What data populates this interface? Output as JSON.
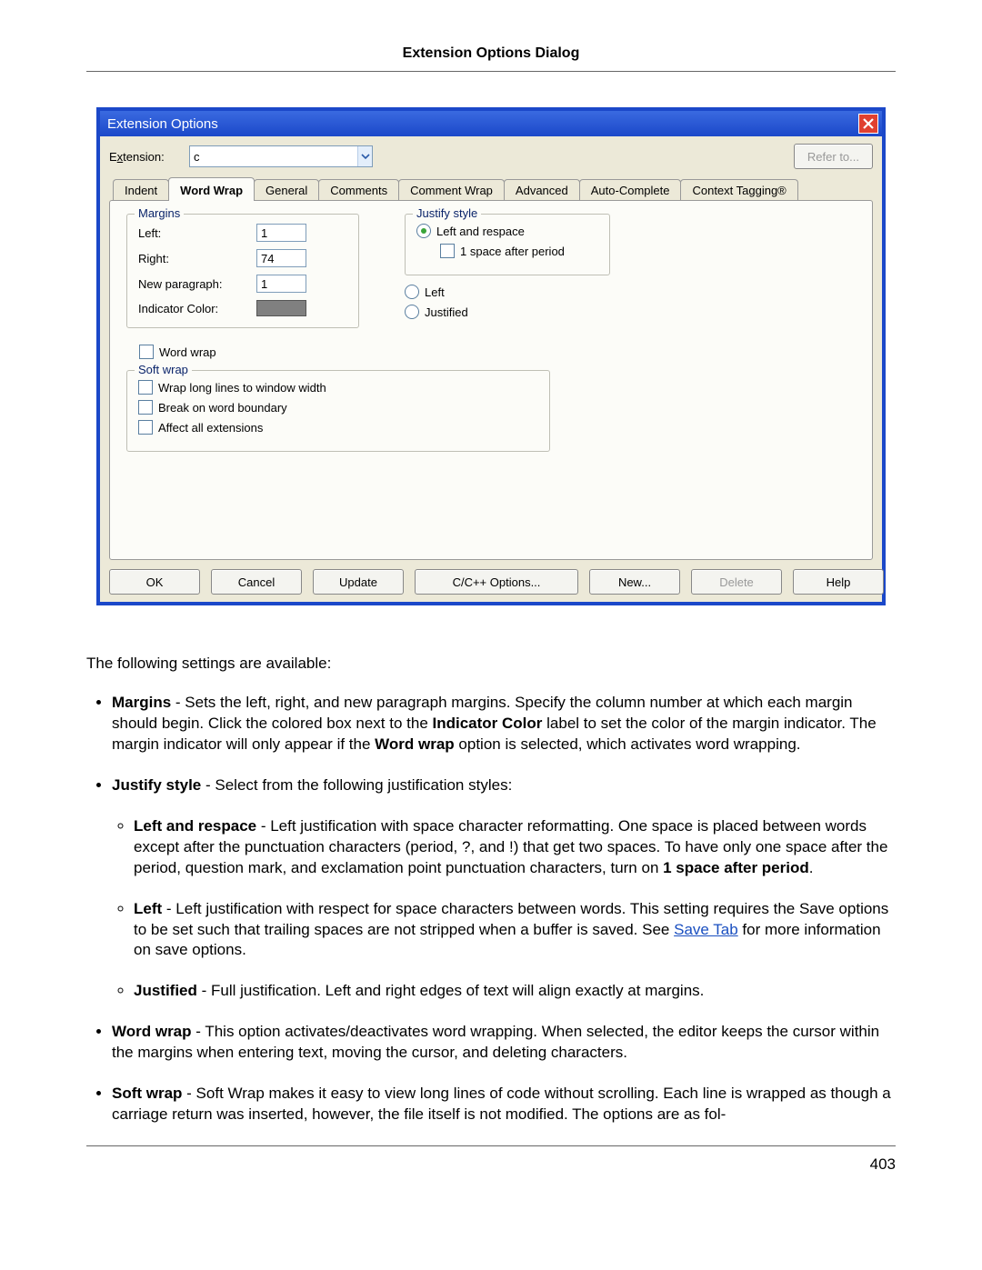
{
  "header_title": "Extension Options Dialog",
  "page_number": "403",
  "dialog": {
    "title": "Extension Options",
    "ext_label_pre": "E",
    "ext_label_under": "x",
    "ext_label_post": "tension:",
    "ext_value": "c",
    "refer_btn": "Refer to...",
    "tabs": [
      "Indent",
      "Word Wrap",
      "General",
      "Comments",
      "Comment Wrap",
      "Advanced",
      "Auto-Complete",
      "Context Tagging®"
    ],
    "margins": {
      "legend": "Margins",
      "left_lbl": "Left:",
      "left_val": "1",
      "right_lbl": "Right:",
      "right_val": "74",
      "newpara_lbl": "New paragraph:",
      "newpara_val": "1",
      "color_lbl": "Indicator Color:",
      "color_hex": "#808080"
    },
    "justify": {
      "legend": "Justify style",
      "opt1": "Left and respace",
      "sub_check": "1 space after period",
      "opt2": "Left",
      "opt3": "Justified"
    },
    "word_wrap_chk": "Word wrap",
    "soft_wrap": {
      "legend": "Soft wrap",
      "o1": "Wrap long lines to window width",
      "o2": "Break on word boundary",
      "o3": "Affect all extensions"
    },
    "buttons": {
      "ok": "OK",
      "cancel": "Cancel",
      "update": "Update",
      "lang": "C/C++ Options...",
      "new_": "New...",
      "delete_": "Delete",
      "help": "Help"
    }
  },
  "desc": {
    "intro": "The following settings are available:",
    "margins_b": "Margins",
    "margins_t1": " - Sets the left, right, and new paragraph margins. Specify the column number at which each margin should begin. Click the colored box next to the ",
    "margins_b2": "Indicator Color",
    "margins_t2": " label to set the color of the margin indicator. The margin indicator will only appear if the ",
    "margins_b3": "Word wrap",
    "margins_t3": " option is selected, which activates word wrapping.",
    "justify_b": "Justify style",
    "justify_t": " - Select from the following justification styles:",
    "lr_b": "Left and respace",
    "lr_t1": " - Left justification with space character reformatting. One space is placed between words except after the punctuation characters (period, ?, and !) that get two spaces. To have only one space after the period, question mark, and exclamation point punctuation characters, turn on ",
    "lr_b2": "1 space after period",
    "lr_t2": ".",
    "left_b": "Left",
    "left_t1": " - Left justification with respect for space characters between words. This setting requires the Save options to be set such that trailing spaces are not stripped when a buffer is saved. See ",
    "left_link": "Save Tab",
    "left_t2": " for more information on save options.",
    "just_b": "Justified",
    "just_t": " - Full justification. Left and right edges of text will align exactly at margins.",
    "ww_b": "Word wrap",
    "ww_t": " - This option activates/deactivates word wrapping. When selected, the editor keeps the cursor within the margins when entering text, moving the cursor, and deleting characters.",
    "sw_b": "Soft wrap",
    "sw_t": " - Soft Wrap makes it easy to view long lines of code without scrolling. Each line is wrapped as though a carriage return was inserted, however, the file itself is not modified. The options are as fol-"
  }
}
